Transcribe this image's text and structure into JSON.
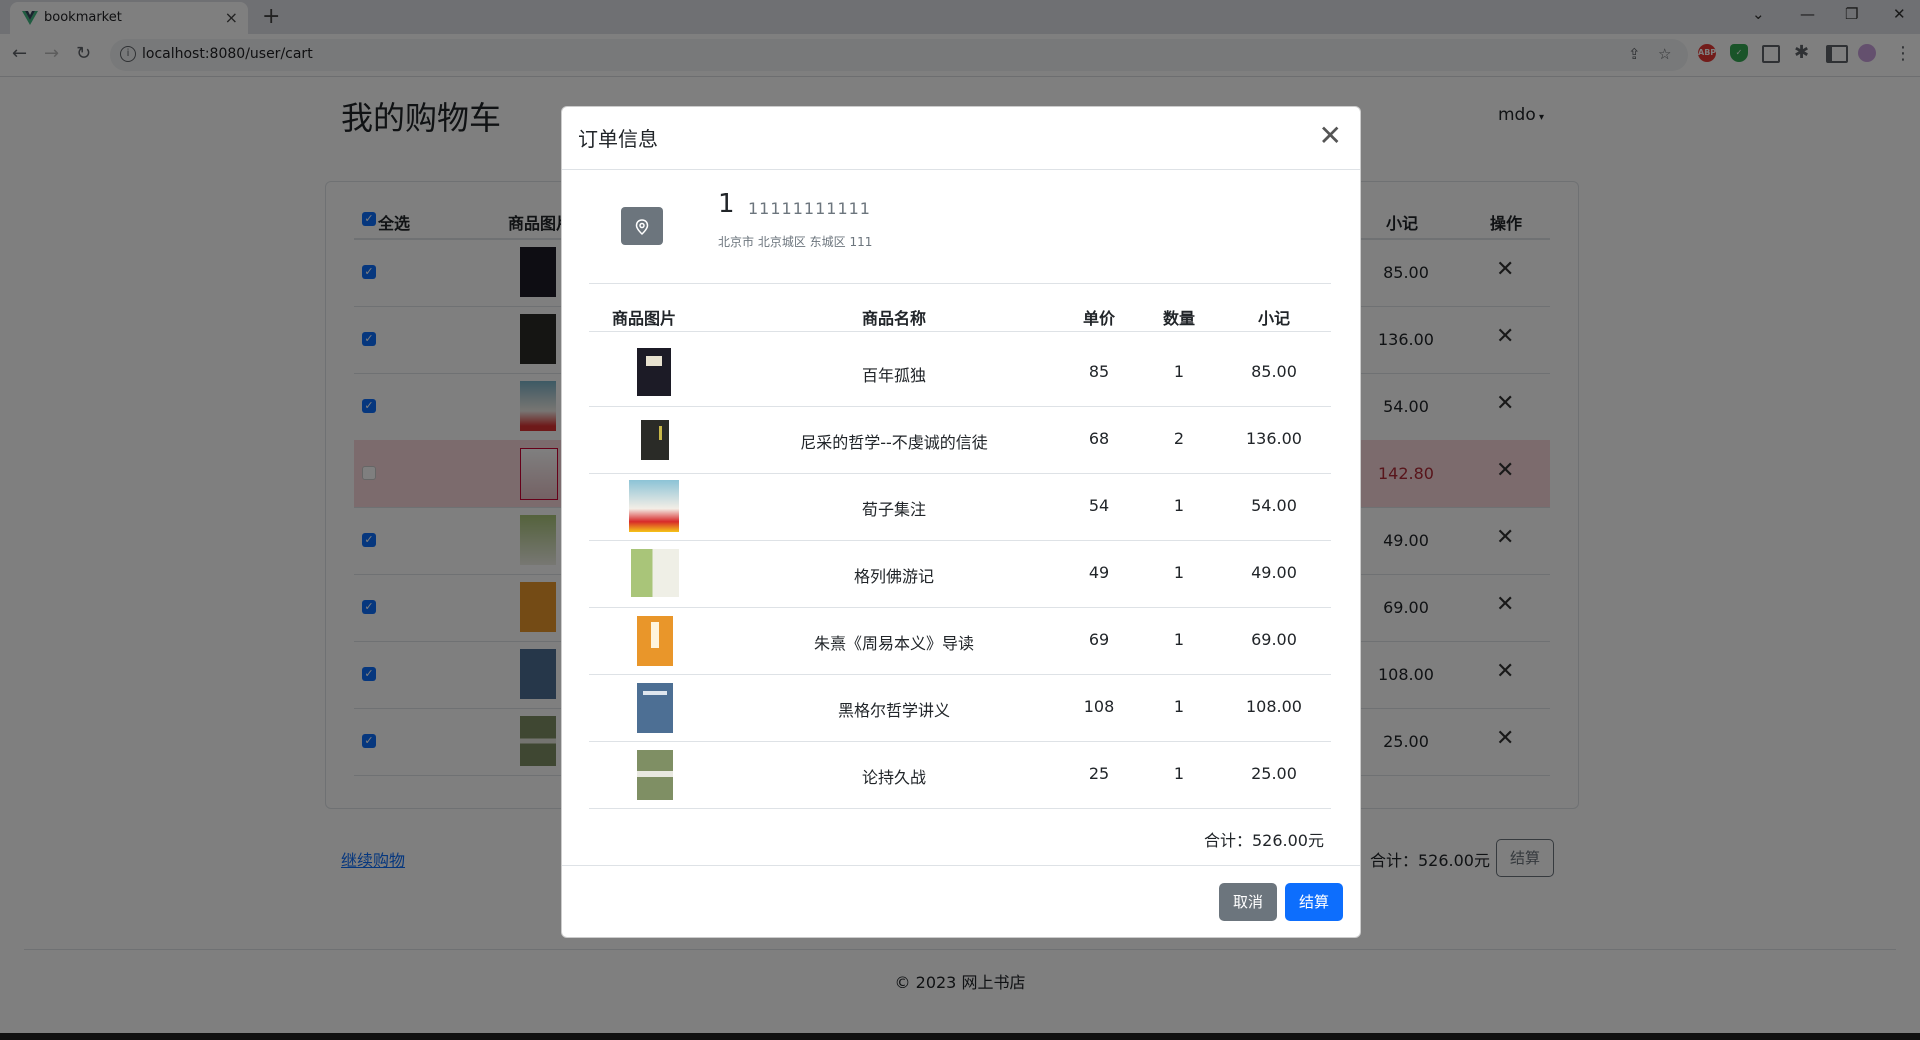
{
  "browser": {
    "tab_title": "bookmarket",
    "url": "localhost:8080/user/cart",
    "tab_close": "×",
    "new_tab": "+"
  },
  "page": {
    "title": "我的购物车",
    "user_menu": "mdo",
    "table_headers": {
      "select_all": "全选",
      "image": "商品图片",
      "subtotal": "小记",
      "action": "操作"
    },
    "rows": [
      {
        "subtotal": "85.00",
        "checked": true
      },
      {
        "subtotal": "136.00",
        "checked": true
      },
      {
        "subtotal": "54.00",
        "checked": true
      },
      {
        "subtotal": "142.80",
        "checked": false
      },
      {
        "subtotal": "49.00",
        "checked": true
      },
      {
        "subtotal": "69.00",
        "checked": true
      },
      {
        "subtotal": "108.00",
        "checked": true
      },
      {
        "subtotal": "25.00",
        "checked": true
      }
    ],
    "continue_shopping": "继续购物",
    "total_label": "合计：526.00元",
    "checkout": "结算",
    "footer": "© 2023 网上书店"
  },
  "modal": {
    "title": "订单信息",
    "address": {
      "name": "1",
      "phone": "11111111111",
      "detail": "北京市 北京城区 东城区 111"
    },
    "headers": {
      "image": "商品图片",
      "name": "商品名称",
      "price": "单价",
      "qty": "数量",
      "subtotal": "小记"
    },
    "items": [
      {
        "name": "百年孤独",
        "price": "85",
        "qty": "1",
        "subtotal": "85.00"
      },
      {
        "name": "尼采的哲学--不虔诚的信徒",
        "price": "68",
        "qty": "2",
        "subtotal": "136.00"
      },
      {
        "name": "荀子集注",
        "price": "54",
        "qty": "1",
        "subtotal": "54.00"
      },
      {
        "name": "格列佛游记",
        "price": "49",
        "qty": "1",
        "subtotal": "49.00"
      },
      {
        "name": "朱熹《周易本义》导读",
        "price": "69",
        "qty": "1",
        "subtotal": "69.00"
      },
      {
        "name": "黑格尔哲学讲义",
        "price": "108",
        "qty": "1",
        "subtotal": "108.00"
      },
      {
        "name": "论持久战",
        "price": "25",
        "qty": "1",
        "subtotal": "25.00"
      }
    ],
    "total": "合计：526.00元",
    "cancel": "取消",
    "checkout": "结算"
  },
  "colors": {
    "primary": "#0d6efd",
    "secondary": "#6c757d",
    "danger_row": "#f8d7da"
  }
}
